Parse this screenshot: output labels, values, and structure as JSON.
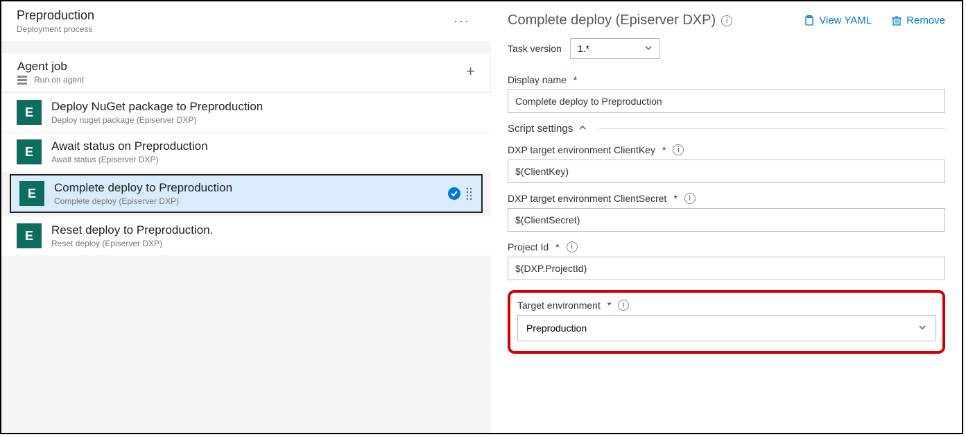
{
  "leftHeader": {
    "title": "Preproduction",
    "subtitle": "Deployment process"
  },
  "agentJob": {
    "title": "Agent job",
    "subtitle": "Run on agent"
  },
  "tasks": [
    {
      "title": "Deploy NuGet package to Preproduction",
      "subtitle": "Deploy nuget package (Episerver DXP)",
      "iconLetter": "E",
      "selected": false
    },
    {
      "title": "Await status on Preproduction",
      "subtitle": "Await status (Episerver DXP)",
      "iconLetter": "E",
      "selected": false
    },
    {
      "title": "Complete deploy to Preproduction",
      "subtitle": "Complete deploy (Episerver DXP)",
      "iconLetter": "E",
      "selected": true
    },
    {
      "title": "Reset deploy to Preproduction.",
      "subtitle": "Reset deploy (Episerver DXP)",
      "iconLetter": "E",
      "selected": false
    }
  ],
  "rightHeader": {
    "title": "Complete deploy (Episerver DXP)",
    "viewYaml": "View YAML",
    "remove": "Remove"
  },
  "taskVersion": {
    "label": "Task version",
    "value": "1.*"
  },
  "displayName": {
    "label": "Display name",
    "value": "Complete deploy to Preproduction"
  },
  "scriptSettings": {
    "title": "Script settings"
  },
  "clientKey": {
    "label": "DXP target environment ClientKey",
    "value": "$(ClientKey)"
  },
  "clientSecret": {
    "label": "DXP target environment ClientSecret",
    "value": "$(ClientSecret)"
  },
  "projectId": {
    "label": "Project Id",
    "value": "$(DXP.ProjectId)"
  },
  "targetEnv": {
    "label": "Target environment",
    "value": "Preproduction"
  }
}
